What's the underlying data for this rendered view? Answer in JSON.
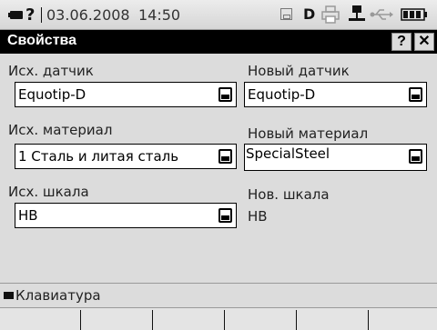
{
  "status": {
    "help_mark": "?",
    "date": "03.06.2008",
    "time": "14:50",
    "drive_letter": "D"
  },
  "window": {
    "title": "Свойства",
    "help_btn": "?",
    "close_btn": "✕"
  },
  "form": {
    "src_sensor_label": "Исх. датчик",
    "src_sensor_value": "Equotip-D",
    "new_sensor_label": "Новый датчик",
    "new_sensor_value": "Equotip-D",
    "src_material_label": "Исх. материал",
    "src_material_value": "1 Сталь и литая сталь",
    "new_material_label": "Новый материал",
    "new_material_value": "SpecialSteel",
    "src_scale_label": "Исх. шкала",
    "src_scale_value": "HB",
    "new_scale_label": "Нов. шкала",
    "new_scale_value": "HB"
  },
  "keyboard": {
    "label": "Клавиатура"
  },
  "softkeys": [
    "",
    "",
    "",
    "",
    "",
    ""
  ]
}
